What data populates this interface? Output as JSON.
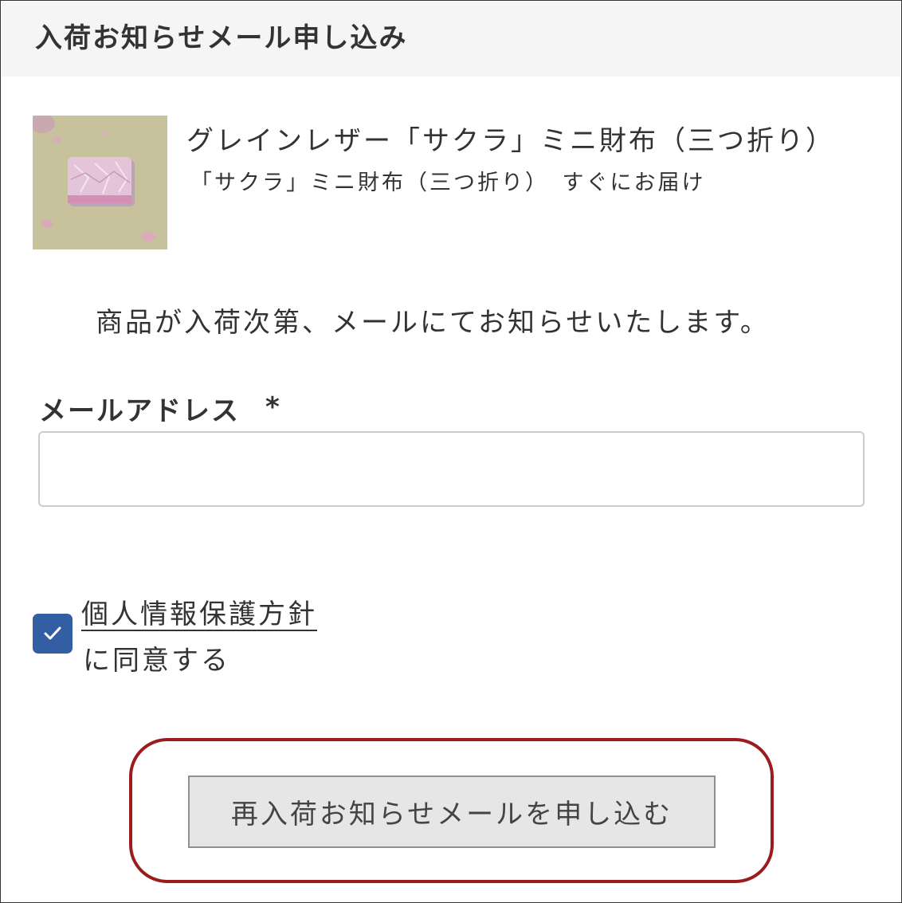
{
  "header": {
    "title": "入荷お知らせメール申し込み"
  },
  "product": {
    "name": "グレインレザー「サクラ」ミニ財布（三つ折り）",
    "variant": "「サクラ」ミニ財布（三つ折り）　すぐにお届け",
    "image_icon": "product-photo"
  },
  "notice": "商品が入荷次第、メールにてお知らせいたします。",
  "form": {
    "email_label": "メールアドレス",
    "required_mark": "*",
    "email_value": "",
    "email_placeholder": "",
    "privacy_link": "個人情報保護方針",
    "agree_text": "に同意する",
    "agree_checked": true,
    "checkbox_color": "#335ea3",
    "submit_label": "再入荷お知らせメールを申し込む"
  },
  "colors": {
    "highlight": "#9b1c1c",
    "button_bg": "#e6e6e6",
    "header_bg": "#f5f5f5"
  }
}
